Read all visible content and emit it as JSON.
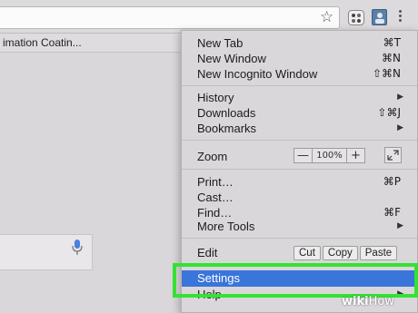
{
  "bookmarks_bar": {
    "item_label": "imation Coatin..."
  },
  "toolbar": {
    "star_icon": "star-icon",
    "ext1_icon": "extension-icon",
    "ext2_icon": "profile-extension-icon",
    "menu_icon": "kebab-menu-icon"
  },
  "menu": {
    "new_tab": {
      "label": "New Tab",
      "shortcut": "⌘T"
    },
    "new_window": {
      "label": "New Window",
      "shortcut": "⌘N"
    },
    "new_incognito": {
      "label": "New Incognito Window",
      "shortcut": "⇧⌘N"
    },
    "history": {
      "label": "History"
    },
    "downloads": {
      "label": "Downloads",
      "shortcut": "⇧⌘J"
    },
    "bookmarks": {
      "label": "Bookmarks"
    },
    "zoom": {
      "label": "Zoom",
      "minus": "—",
      "value": "100%",
      "plus": "+"
    },
    "print": {
      "label": "Print…",
      "shortcut": "⌘P"
    },
    "cast": {
      "label": "Cast…"
    },
    "find": {
      "label": "Find…",
      "shortcut": "⌘F"
    },
    "more_tools": {
      "label": "More Tools"
    },
    "edit": {
      "label": "Edit",
      "cut": "Cut",
      "copy": "Copy",
      "paste": "Paste"
    },
    "settings": {
      "label": "Settings"
    },
    "help": {
      "label": "Help"
    }
  },
  "colors": {
    "highlight": "#3a75d9",
    "callout": "#33e233"
  },
  "watermark": {
    "wiki": "wiki",
    "how": "How"
  }
}
